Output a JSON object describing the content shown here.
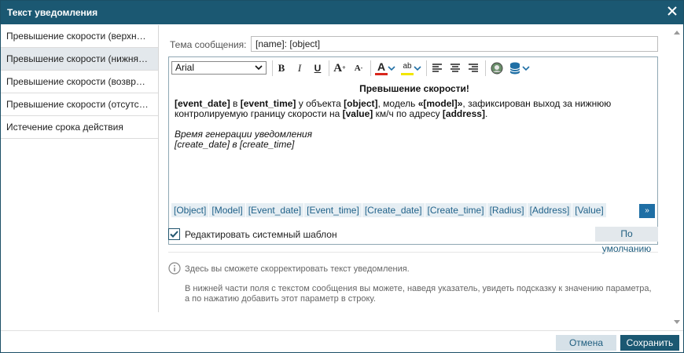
{
  "dialog": {
    "title": "Текст уведомления"
  },
  "sidebar": {
    "items": [
      {
        "label": "Превышение скорости (верхняя г..."
      },
      {
        "label": "Превышение скорости (нижняя гр..."
      },
      {
        "label": "Превышение скорости (возврат в ..."
      },
      {
        "label": "Превышение скорости (отсутстви..."
      },
      {
        "label": "Истечение срока действия"
      }
    ],
    "active_index": 1
  },
  "subject": {
    "label": "Тема сообщения:",
    "value": "[name]: [object]"
  },
  "toolbar": {
    "font": "Arial",
    "bold": "B",
    "italic": "I",
    "underline": "U",
    "grow": "A",
    "shrink": "A",
    "text_color": "A",
    "highlight_color": "ab",
    "icons": [
      "bold-icon",
      "italic-icon",
      "underline-icon",
      "font-grow-icon",
      "font-shrink-icon",
      "font-color-icon",
      "highlight-icon",
      "align-left-icon",
      "align-center-icon",
      "align-right-icon",
      "image-icon",
      "database-icon"
    ]
  },
  "editor": {
    "heading": "Превышение скорости!",
    "p1_a": "[event_date]",
    "p1_b": " в ",
    "p1_c": "[event_time]",
    "p1_d": " у объекта ",
    "p1_e": "[object]",
    "p1_f": ", модель ",
    "p1_g": "«[model]»",
    "p1_h": ", зафиксирован выход за нижнюю контролируемую границу скорости на ",
    "p1_i": "[value]",
    "p1_j": " км/ч по адресу ",
    "p1_k": "[address]",
    "p1_l": ".",
    "p2_line1": "Время генерации уведомления",
    "p2_line2": "[create_date] в [create_time]"
  },
  "tags": [
    "[Object]",
    "[Model]",
    "[Event_date]",
    "[Event_time]",
    "[Create_date]",
    "[Create_time]",
    "[Radius]",
    "[Address]",
    "[Value]"
  ],
  "more_button": "»",
  "edit_template": {
    "label": "Редактировать системный шаблон",
    "checked": true
  },
  "default_button": "По умолчанию",
  "info": {
    "line1": "Здесь вы сможете скорректировать текст уведомления.",
    "line2": "В нижней части поля с текстом сообщения вы можете, наведя указатель, увидеть подсказку к значению параметра, а по нажатию добавить этот параметр в строку."
  },
  "footer": {
    "cancel": "Отмена",
    "save": "Сохранить"
  },
  "colors": {
    "titlebar": "#1b5872",
    "accent": "#1f6fa5",
    "text_color_underline": "#d9261c",
    "highlight_underline": "#f2e600"
  }
}
